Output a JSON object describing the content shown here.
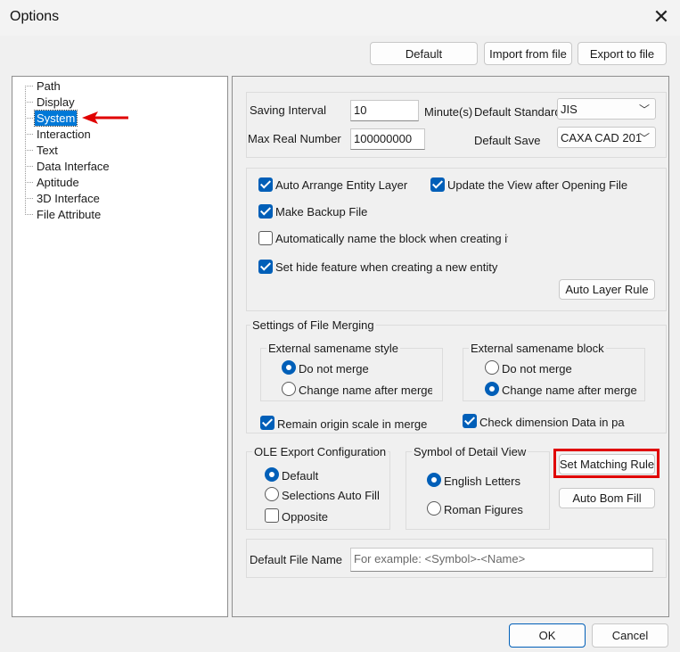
{
  "window": {
    "title": "Options"
  },
  "toolbar": {
    "default_label": "Default",
    "import_label": "Import from file",
    "export_label": "Export to file"
  },
  "tree": {
    "items": [
      {
        "label": "Path"
      },
      {
        "label": "Display"
      },
      {
        "label": "System",
        "selected": true
      },
      {
        "label": "Interaction"
      },
      {
        "label": "Text"
      },
      {
        "label": "Data Interface"
      },
      {
        "label": "Aptitude"
      },
      {
        "label": "3D Interface"
      },
      {
        "label": "File Attribute"
      }
    ]
  },
  "general": {
    "saving_interval_label": "Saving Interval",
    "saving_interval_value": "10",
    "minutes_label": "Minute(s)",
    "default_standard_label": "Default Standard",
    "default_standard_value": "JIS",
    "max_real_label": "Max Real Number",
    "max_real_value": "100000000",
    "default_save_label": "Default Save",
    "default_save_value": "CAXA CAD 201"
  },
  "options": {
    "auto_arrange": "Auto Arrange Entity Layer",
    "update_view": "Update the View after Opening File",
    "make_backup": "Make Backup File",
    "auto_name_block": "Automatically name the block when creating it",
    "hide_feature": "Set hide feature when creating a new entity",
    "auto_layer_rule": "Auto Layer Rule"
  },
  "merging": {
    "title": "Settings of File Merging",
    "style_title": "External samename style",
    "style_opt1": "Do not merge",
    "style_opt2": "Change name after merge",
    "block_title": "External samename block",
    "block_opt1": "Do not merge",
    "block_opt2": "Change name after merge",
    "remain_scale": "Remain origin scale in merge",
    "check_dimension": "Check dimension Data in paste"
  },
  "ole": {
    "title": "OLE Export Configuration",
    "opt1": "Default",
    "opt2": "Selections Auto Fill",
    "opposite": "Opposite"
  },
  "symbol": {
    "title": "Symbol of Detail View",
    "opt1": "English Letters",
    "opt2": "Roman Figures"
  },
  "actions": {
    "set_matching_rule": "Set Matching Rule",
    "auto_bom_fill": "Auto Bom Fill"
  },
  "filename": {
    "label": "Default File Name",
    "placeholder": "For example: <Symbol>-<Name>"
  },
  "footer": {
    "ok": "OK",
    "cancel": "Cancel"
  },
  "colors": {
    "accent": "#005fb8",
    "annotation_red": "#e00000",
    "selection": "#0078d7"
  }
}
